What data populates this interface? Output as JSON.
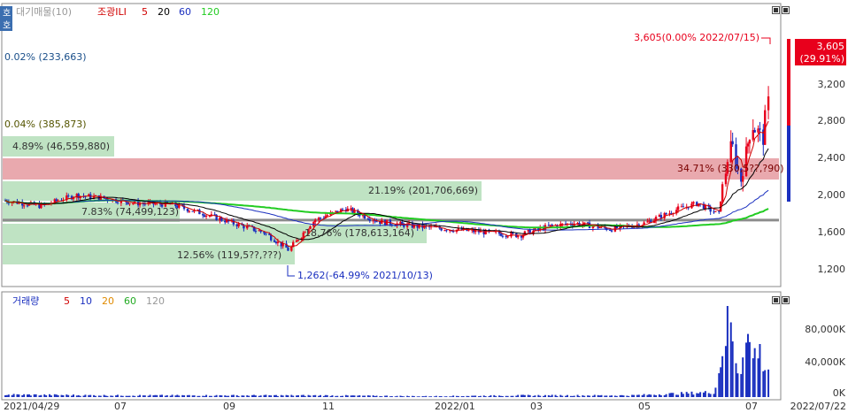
{
  "price_panel": {
    "legend": [
      {
        "label": "대기매물(10)",
        "color": "#999999"
      },
      {
        "label": "조광ILI",
        "color": "#d00000"
      },
      {
        "label": "5",
        "color": "#d00000"
      },
      {
        "label": "20",
        "color": "#000000"
      },
      {
        "label": "60",
        "color": "#1a2fbf"
      },
      {
        "label": "120",
        "color": "#22cc22"
      }
    ],
    "current_price": "3,605",
    "current_change": "(29.91%)",
    "high_annotation": "3,605(0.00% 2022/07/15)",
    "low_annotation": "1,262(-64.99% 2021/10/13)",
    "y_ticks": [
      "3,200",
      "2,800",
      "2,400",
      "2,000",
      "1,600",
      "1,200"
    ],
    "overlay_labels": [
      "0.02% (233,663)",
      "0.04% (385,873)",
      "4.89% (46,559,880)",
      "34.71% (330,5??,?90)",
      "21.19% (201,706,669)",
      "7.83% (74,499,123)",
      "18.76% (178,613,164)",
      "12.56% (119,5??,???)"
    ]
  },
  "volume_panel": {
    "legend": [
      {
        "label": "거래량",
        "color": "#1a2fbf"
      },
      {
        "label": "5",
        "color": "#d00000"
      },
      {
        "label": "10",
        "color": "#1a2fbf"
      },
      {
        "label": "20",
        "color": "#e08a00"
      },
      {
        "label": "60",
        "color": "#22aa22"
      },
      {
        "label": "120",
        "color": "#999999"
      }
    ],
    "y_ticks": [
      "80,000K",
      "40,000K",
      "0K"
    ]
  },
  "x_axis": {
    "labels": [
      "2021/04/29",
      "07",
      "09",
      "11",
      "2022/01",
      "03",
      "05",
      "07",
      "2022/07/22"
    ]
  },
  "colors": {
    "up": "#e8001c",
    "down": "#1a2fbf",
    "ma5": "#d00000",
    "ma20": "#000000",
    "ma60": "#1a2fbf",
    "ma120": "#22cc22",
    "zone_red": "#e9a9ae",
    "zone_green": "#bfe3c3",
    "grid": "#cccccc"
  },
  "chart_data": {
    "type": "candlestick",
    "title": "조광ILI",
    "x_range": [
      "2021/04/29",
      "2022/07/22"
    ],
    "ylim": [
      1100,
      3750
    ],
    "y_scale": "log",
    "price_path": [
      [
        "2021/04/29",
        1620
      ],
      [
        "2021/05/20",
        1580
      ],
      [
        "2021/06/10",
        1660
      ],
      [
        "2021/06/25",
        1640
      ],
      [
        "2021/07/15",
        1600
      ],
      [
        "2021/08/05",
        1590
      ],
      [
        "2021/08/25",
        1520
      ],
      [
        "2021/09/10",
        1460
      ],
      [
        "2021/09/28",
        1400
      ],
      [
        "2021/10/13",
        1290
      ],
      [
        "2021/10/28",
        1480
      ],
      [
        "2021/11/15",
        1560
      ],
      [
        "2021/12/05",
        1470
      ],
      [
        "2021/12/25",
        1440
      ],
      [
        "2022/01/15",
        1420
      ],
      [
        "2022/02/05",
        1400
      ],
      [
        "2022/02/25",
        1380
      ],
      [
        "2022/03/15",
        1440
      ],
      [
        "2022/03/30",
        1460
      ],
      [
        "2022/04/20",
        1420
      ],
      [
        "2022/05/10",
        1460
      ],
      [
        "2022/05/30",
        1560
      ],
      [
        "2022/06/10",
        1600
      ],
      [
        "2022/06/22",
        1520
      ],
      [
        "2022/06/30",
        2100
      ],
      [
        "2022/07/05",
        1780
      ],
      [
        "2022/07/12",
        2300
      ],
      [
        "2022/07/18",
        2150
      ],
      [
        "2022/07/22",
        2650
      ]
    ],
    "horizontal_line": 1480,
    "volume_path": [
      [
        "2021/04/29",
        3
      ],
      [
        "2021/07/01",
        2
      ],
      [
        "2021/09/01",
        2
      ],
      [
        "2021/11/01",
        2
      ],
      [
        "2022/01/01",
        1
      ],
      [
        "2022/03/01",
        2
      ],
      [
        "2022/05/01",
        2
      ],
      [
        "2022/06/20",
        6
      ],
      [
        "2022/06/29",
        105
      ],
      [
        "2022/07/01",
        50
      ],
      [
        "2022/07/05",
        30
      ],
      [
        "2022/07/08",
        95
      ],
      [
        "2022/07/12",
        45
      ],
      [
        "2022/07/15",
        60
      ],
      [
        "2022/07/20",
        35
      ]
    ],
    "volume_unit": "K",
    "volume_ylim": [
      0,
      110000
    ]
  }
}
